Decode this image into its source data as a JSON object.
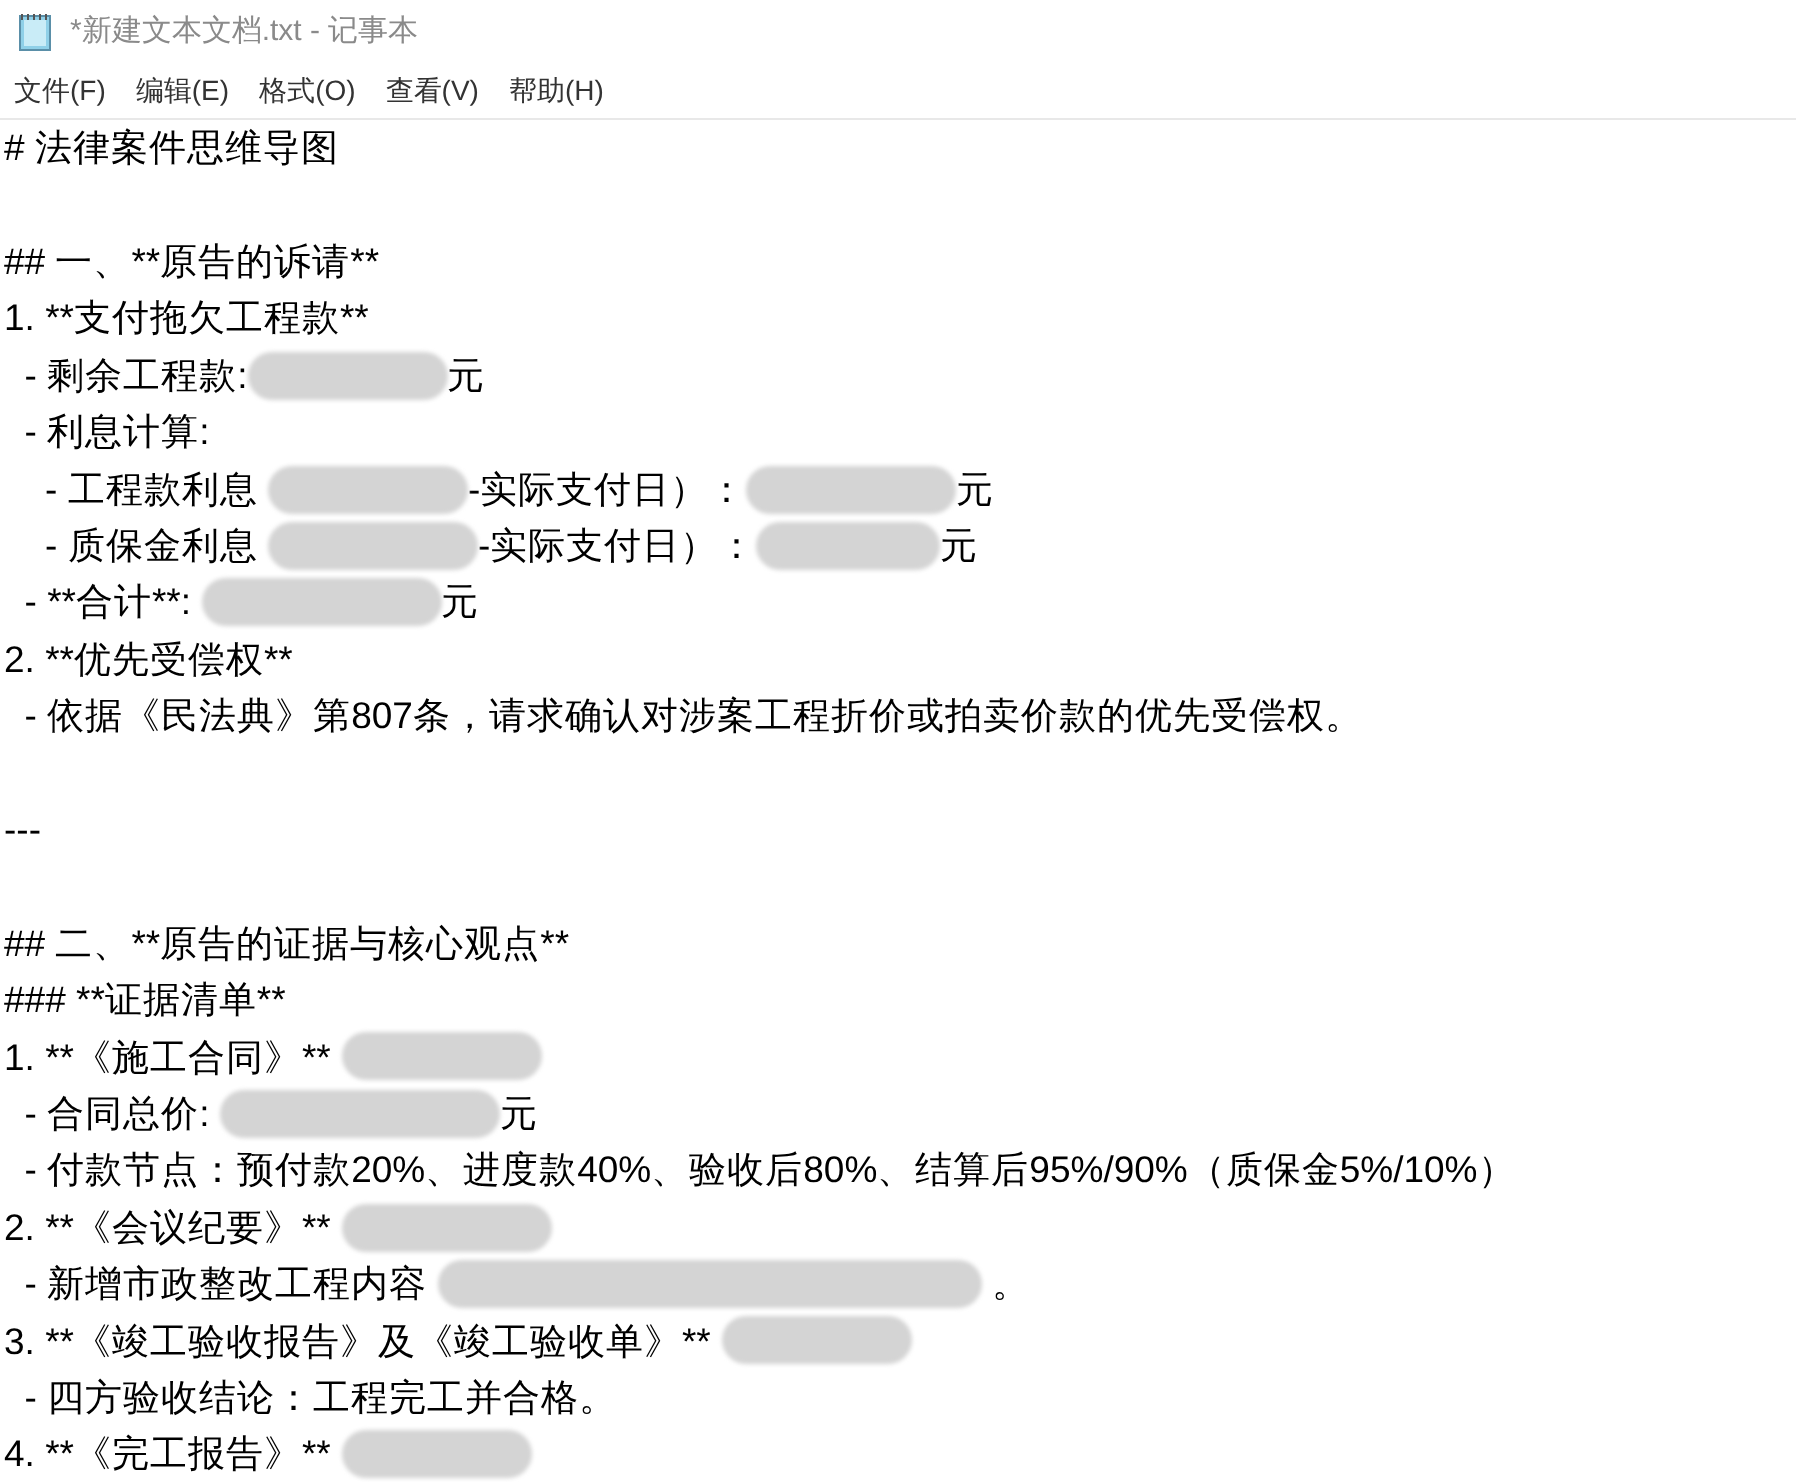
{
  "window": {
    "title": "*新建文本文档.txt - 记事本"
  },
  "menu": [
    "文件(F)",
    "编辑(E)",
    "格式(O)",
    "查看(V)",
    "帮助(H)"
  ],
  "lines": [
    [
      {
        "kind": "text",
        "text": "# 法律案件思维导图"
      }
    ],
    [
      {
        "kind": "blank"
      }
    ],
    [
      {
        "kind": "text",
        "text": "## 一、**原告的诉请**"
      }
    ],
    [
      {
        "kind": "text",
        "text": "1. **支付拖欠工程款**"
      }
    ],
    [
      {
        "kind": "text",
        "text": "  - 剩余工程款:"
      },
      {
        "kind": "redacted"
      },
      {
        "kind": "text",
        "text": "元"
      }
    ],
    [
      {
        "kind": "text",
        "text": "  - 利息计算:"
      }
    ],
    [
      {
        "kind": "text",
        "text": "    - 工程款利息 "
      },
      {
        "kind": "redacted"
      },
      {
        "kind": "text",
        "text": "-实际支付日）："
      },
      {
        "kind": "redacted"
      },
      {
        "kind": "text",
        "text": "元"
      }
    ],
    [
      {
        "kind": "text",
        "text": "    - 质保金利息 "
      },
      {
        "kind": "redacted"
      },
      {
        "kind": "text",
        "text": "-实际支付日）："
      },
      {
        "kind": "redacted"
      },
      {
        "kind": "text",
        "text": "元"
      }
    ],
    [
      {
        "kind": "text",
        "text": "  - **合计**: "
      },
      {
        "kind": "redacted"
      },
      {
        "kind": "text",
        "text": "元"
      }
    ],
    [
      {
        "kind": "text",
        "text": "2. **优先受偿权**"
      }
    ],
    [
      {
        "kind": "text",
        "text": "  - 依据《民法典》第807条，请求确认对涉案工程折价或拍卖价款的优先受偿权。"
      }
    ],
    [
      {
        "kind": "blank"
      }
    ],
    [
      {
        "kind": "text",
        "text": "---"
      }
    ],
    [
      {
        "kind": "blank"
      }
    ],
    [
      {
        "kind": "text",
        "text": "## 二、**原告的证据与核心观点**"
      }
    ],
    [
      {
        "kind": "text",
        "text": "### **证据清单**"
      }
    ],
    [
      {
        "kind": "text",
        "text": "1. **《施工合同》** "
      },
      {
        "kind": "redacted"
      }
    ],
    [
      {
        "kind": "text",
        "text": "  - 合同总价: "
      },
      {
        "kind": "redacted"
      },
      {
        "kind": "text",
        "text": "元"
      }
    ],
    [
      {
        "kind": "text",
        "text": "  - 付款节点：预付款20%、进度款40%、验收后80%、结算后95%/90%（质保金5%/10%）"
      }
    ],
    [
      {
        "kind": "text",
        "text": "2. **《会议纪要》** "
      },
      {
        "kind": "redacted"
      }
    ],
    [
      {
        "kind": "text",
        "text": "  - 新增市政整改工程内容 "
      },
      {
        "kind": "redacted"
      },
      {
        "kind": "text",
        "text": " 。"
      }
    ],
    [
      {
        "kind": "text",
        "text": "3. **《竣工验收报告》及《竣工验收单》** "
      },
      {
        "kind": "redacted"
      }
    ],
    [
      {
        "kind": "text",
        "text": "  - 四方验收结论：工程完工并合格。"
      }
    ],
    [
      {
        "kind": "text",
        "text": "4. **《完工报告》** "
      },
      {
        "kind": "redacted"
      }
    ]
  ]
}
